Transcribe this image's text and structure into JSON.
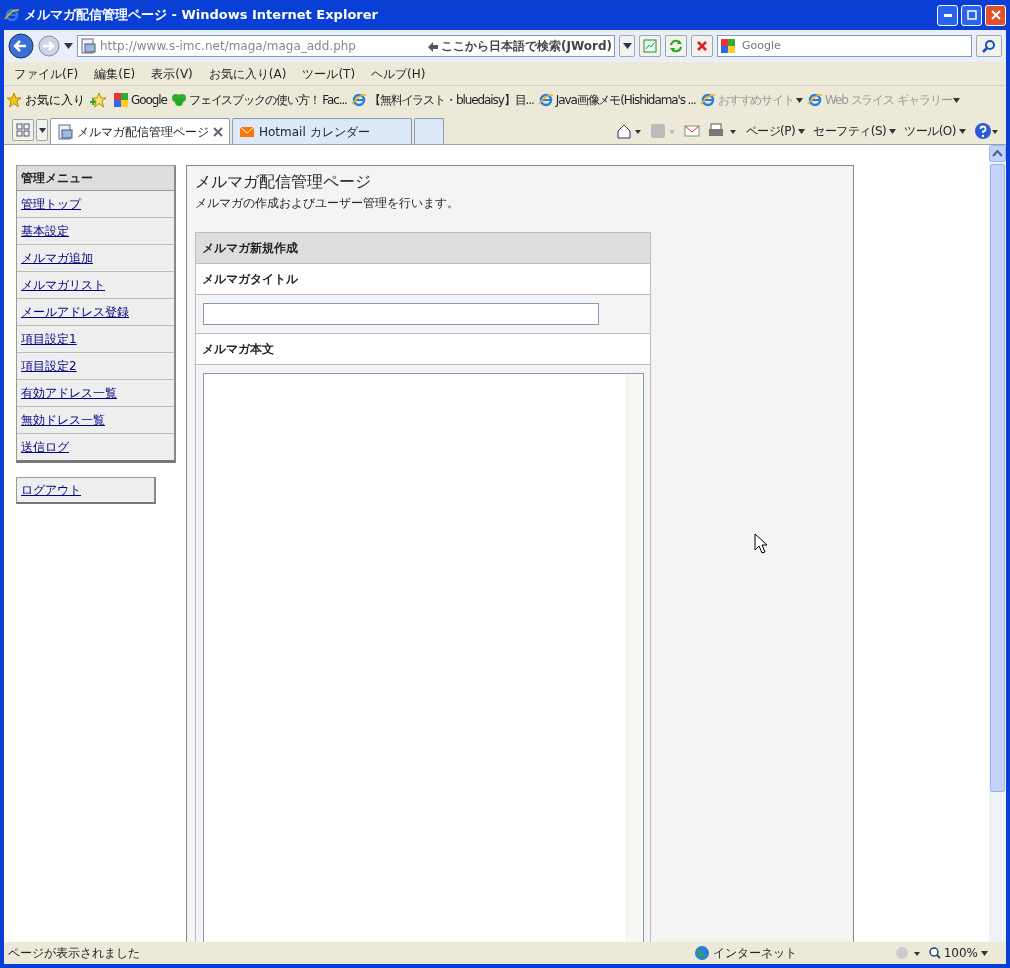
{
  "window": {
    "title": "メルマガ配信管理ページ - Windows Internet Explorer"
  },
  "address": {
    "url": "http://www.s-imc.net/maga/maga_add.php",
    "hint": "ここから日本語で検索(JWord)"
  },
  "search": {
    "placeholder": "Google"
  },
  "menu": [
    "ファイル(F)",
    "編集(E)",
    "表示(V)",
    "お気に入り(A)",
    "ツール(T)",
    "ヘルプ(H)"
  ],
  "favorites": {
    "label": "お気に入り",
    "items": [
      {
        "label": "Google",
        "kind": "google",
        "disabled": false
      },
      {
        "label": "フェイスブックの使い方！ Fac...",
        "kind": "leaf",
        "disabled": false
      },
      {
        "label": "【無料イラスト・bluedaisy】目...",
        "kind": "ie",
        "disabled": false
      },
      {
        "label": "Java画像メモ(Hishidama's ...",
        "kind": "ie",
        "disabled": false
      },
      {
        "label": "おすすめサイト",
        "kind": "ie",
        "disabled": true
      },
      {
        "label": "Web スライス ギャラリー",
        "kind": "ie",
        "disabled": true
      }
    ]
  },
  "tabs": [
    {
      "label": "メルマガ配信管理ページ",
      "selected": true
    },
    {
      "label": "Hotmail カレンダー",
      "selected": false
    }
  ],
  "commands": [
    "ページ(P)",
    "セーフティ(S)",
    "ツール(O)"
  ],
  "sidebar": {
    "heading": "管理メニュー",
    "items": [
      "管理トップ",
      "基本設定",
      "メルマガ追加",
      "メルマガリスト",
      "メールアドレス登録",
      "項目設定1",
      "項目設定2",
      "有効アドレス一覧",
      "無効ドレス一覧",
      "送信ログ"
    ],
    "logout": "ログアウト"
  },
  "main": {
    "title": "メルマガ配信管理ページ",
    "description": "メルマガの作成およびユーザー管理を行います。",
    "form_heading": "メルマガ新規作成",
    "fields": [
      {
        "label": "メルマガタイトル",
        "kind": "input"
      },
      {
        "label": "メルマガ本文",
        "kind": "textarea"
      }
    ]
  },
  "status_bar": {
    "text": "ページが表示されました",
    "zone": "インターネット",
    "zoom": "100%"
  }
}
